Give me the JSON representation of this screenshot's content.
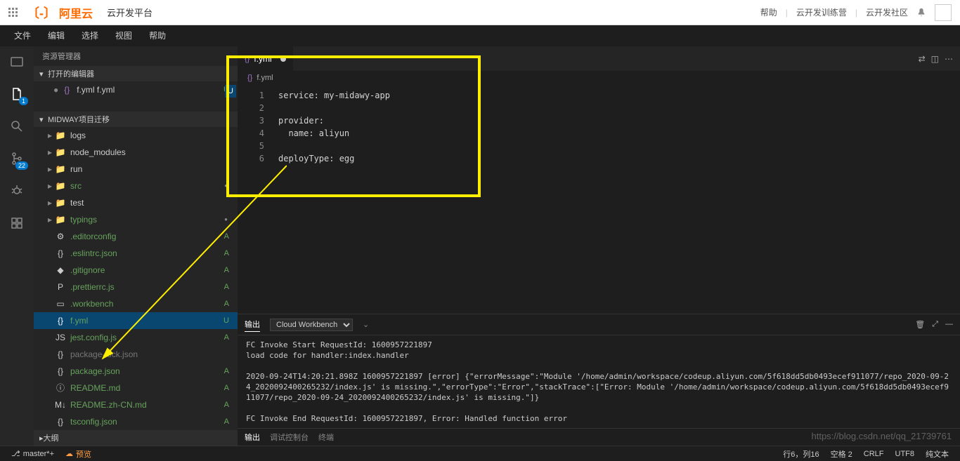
{
  "header": {
    "logo_text": "阿里云",
    "platform": "云开发平台",
    "help": "帮助",
    "camp": "云开发训练营",
    "community": "云开发社区"
  },
  "menu": {
    "file": "文件",
    "edit": "编辑",
    "select": "选择",
    "view": "视图",
    "help": "帮助"
  },
  "activity": {
    "badge1": "1",
    "badge2": "22"
  },
  "sidebar": {
    "title": "资源管理器",
    "open_editors": "打开的编辑器",
    "open_file": "f.yml  f.yml",
    "open_status": "U",
    "project": "MIDWAY项目迁移",
    "tree": [
      {
        "icon": "📁",
        "name": "logs",
        "status": ""
      },
      {
        "icon": "📁",
        "name": "node_modules",
        "status": ""
      },
      {
        "icon": "📁",
        "name": "run",
        "status": ""
      },
      {
        "icon": "📁",
        "name": "src",
        "status": "•",
        "green": true
      },
      {
        "icon": "📁",
        "name": "test",
        "status": ""
      },
      {
        "icon": "📁",
        "name": "typings",
        "status": "•",
        "green": true
      },
      {
        "icon": "⚙",
        "name": ".editorconfig",
        "status": "A",
        "green": true
      },
      {
        "icon": "{}",
        "name": ".eslintrc.json",
        "status": "A",
        "green": true
      },
      {
        "icon": "◆",
        "name": ".gitignore",
        "status": "A",
        "green": true
      },
      {
        "icon": "P",
        "name": ".prettierrc.js",
        "status": "A",
        "green": true
      },
      {
        "icon": "▭",
        "name": ".workbench",
        "status": "A",
        "green": true
      },
      {
        "icon": "{}",
        "name": "f.yml",
        "status": "U",
        "green": true,
        "selected": true
      },
      {
        "icon": "JS",
        "name": "jest.config.js",
        "status": "A",
        "green": true
      },
      {
        "icon": "{}",
        "name": "package-lock.json",
        "status": "",
        "dim": true
      },
      {
        "icon": "{}",
        "name": "package.json",
        "status": "A",
        "green": true
      },
      {
        "icon": "ⓘ",
        "name": "README.md",
        "status": "A",
        "green": true
      },
      {
        "icon": "M↓",
        "name": "README.zh-CN.md",
        "status": "A",
        "green": true
      },
      {
        "icon": "{}",
        "name": "tsconfig.json",
        "status": "A",
        "green": true
      }
    ],
    "outline": "大纲"
  },
  "editor": {
    "tab_name": "f.yml",
    "breadcrumb": "f.yml",
    "u_marker": "U",
    "lines": [
      "1",
      "2",
      "3",
      "4",
      "5",
      "6"
    ],
    "code": "service: my-midawy-app\n\nprovider:\n  name: aliyun\n\ndeployType: egg"
  },
  "panel": {
    "output_tab": "输出",
    "workbench": "Cloud Workbench",
    "content": "FC Invoke Start RequestId: 1600957221897\nload code for handler:index.handler\n\n2020-09-24T14:20:21.898Z 1600957221897 [error] {\"errorMessage\":\"Module '/home/admin/workspace/codeup.aliyun.com/5f618dd5db0493ecef911077/repo_2020-09-24_2020092400265232/index.js' is missing.\",\"errorType\":\"Error\",\"stackTrace\":[\"Error: Module '/home/admin/workspace/codeup.aliyun.com/5f618dd5db0493ecef911077/repo_2020-09-24_2020092400265232/index.js' is missing.\"]}\n\nFC Invoke End RequestId: 1600957221897, Error: Handled function error",
    "bottom_output": "输出",
    "bottom_debug": "调试控制台",
    "bottom_terminal": "终端"
  },
  "statusbar": {
    "branch": "master*+",
    "preview": "预览",
    "pos": "行6，列16",
    "spaces": "空格 2",
    "crlf": "CRLF",
    "encoding": "UTF8",
    "mode": "纯文本"
  },
  "watermark": "https://blog.csdn.net/qq_21739761"
}
